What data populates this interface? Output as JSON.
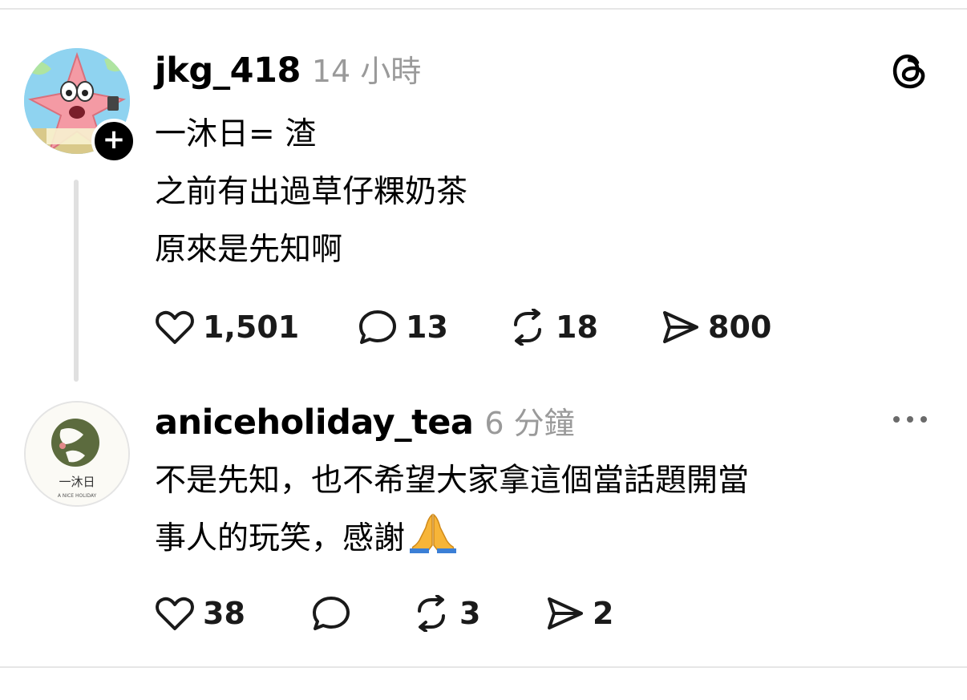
{
  "posts": [
    {
      "username": "jkg_418",
      "time": "14 小時",
      "lines": [
        "一沐日= 渣",
        "之前有出過草仔粿奶茶",
        "原來是先知啊"
      ],
      "actions": {
        "likes": "1,501",
        "replies": "13",
        "reposts": "18",
        "shares": "800"
      },
      "avatar_icon": "patrick-star-avatar",
      "corner_icon": "threads-logo-icon"
    },
    {
      "username": "aniceholiday_tea",
      "time": "6 分鐘",
      "lines": [
        "不是先知，也不希望大家拿這個當話題開當",
        "事人的玩笑，感謝"
      ],
      "emoji": "folded-hands-emoji",
      "actions": {
        "likes": "38",
        "replies": "",
        "reposts": "3",
        "shares": "2"
      },
      "avatar_text": "一沐日",
      "avatar_subtext": "A NICE HOLIDAY",
      "corner_icon": "more-options-icon"
    }
  ],
  "colors": {
    "text": "#000000",
    "muted": "#9a9a9a",
    "divider": "#e6e6e6"
  }
}
